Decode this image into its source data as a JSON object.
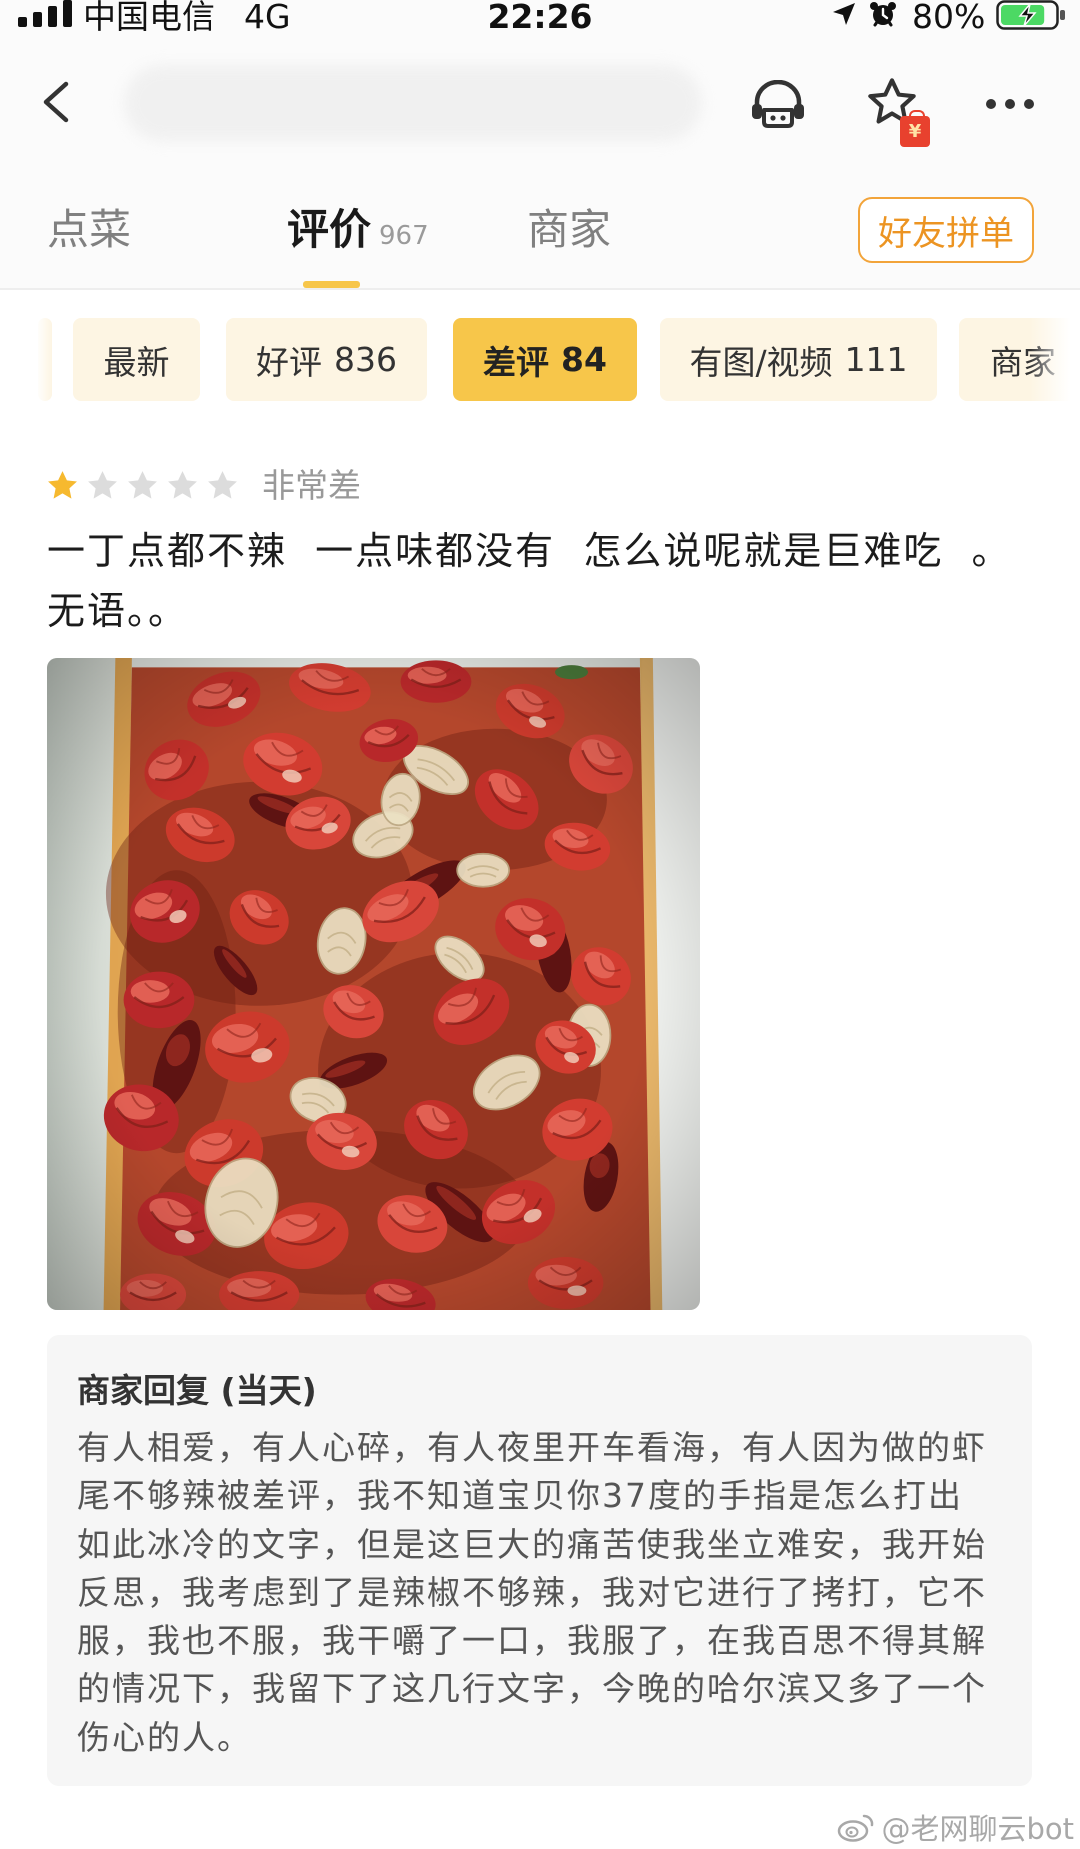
{
  "status_bar": {
    "carrier": "中国电信",
    "network": "4G",
    "time": "22:26",
    "battery_percent": "80%",
    "battery_level": 0.8,
    "charging": true,
    "icons": [
      "signal-icon",
      "location-icon",
      "alarm-icon",
      "battery-icon"
    ]
  },
  "nav": {
    "icons": [
      "back-icon",
      "customer-service-icon",
      "favorite-star-icon",
      "more-icon"
    ],
    "favorite_badge": "¥"
  },
  "tabs": [
    {
      "label": "点菜",
      "count": "",
      "active": false
    },
    {
      "label": "评价",
      "count": "967",
      "active": true
    },
    {
      "label": "商家",
      "count": "",
      "active": false
    }
  ],
  "group_order_button": {
    "label": "好友拼单"
  },
  "filters": [
    {
      "label": "最新",
      "count": "",
      "selected": false
    },
    {
      "label": "好评",
      "count": "836",
      "selected": false
    },
    {
      "label": "差评",
      "count": "84",
      "selected": true
    },
    {
      "label": "有图/视频",
      "count": "111",
      "selected": false
    },
    {
      "label": "商家",
      "count": "",
      "selected": false
    }
  ],
  "review": {
    "rating": 1,
    "rating_max": 5,
    "rating_text": "非常差",
    "text_lines": [
      "一丁点都不辣  一点味都没有  怎么说呢就是巨难吃  。",
      "无语。。"
    ]
  },
  "merchant_reply": {
    "title": "商家回复 (当天)",
    "lines": [
      "有人相爱，有人心碎，有人夜里开车看海，有人因为做的虾",
      "尾不够辣被差评，我不知道宝贝你37度的手指是怎么打出",
      "如此冰冷的文字，但是这巨大的痛苦使我坐立难安，我开始",
      "反思，我考虑到了是辣椒不够辣，我对它进行了拷打，它不",
      "服，我也不服，我干嚼了一口，我服了，在我百思不得其解",
      "的情况下，我留下了这几行文字，今晚的哈尔滨又多了一个",
      "伤心的人。"
    ]
  },
  "watermark": {
    "text": "@老网聊云bot",
    "logo": "weibo-logo-icon"
  },
  "colors": {
    "accent": "#f7c64a",
    "chip_bg": "#fdf5e3",
    "button_border": "#f2a43a",
    "button_text": "#ec9422",
    "star_active": "#f6b92f",
    "star_inactive": "#dcdcdc",
    "reply_bg": "#f6f6f6",
    "battery_fill": "#4cd964",
    "tag_red": "#e8412e"
  }
}
